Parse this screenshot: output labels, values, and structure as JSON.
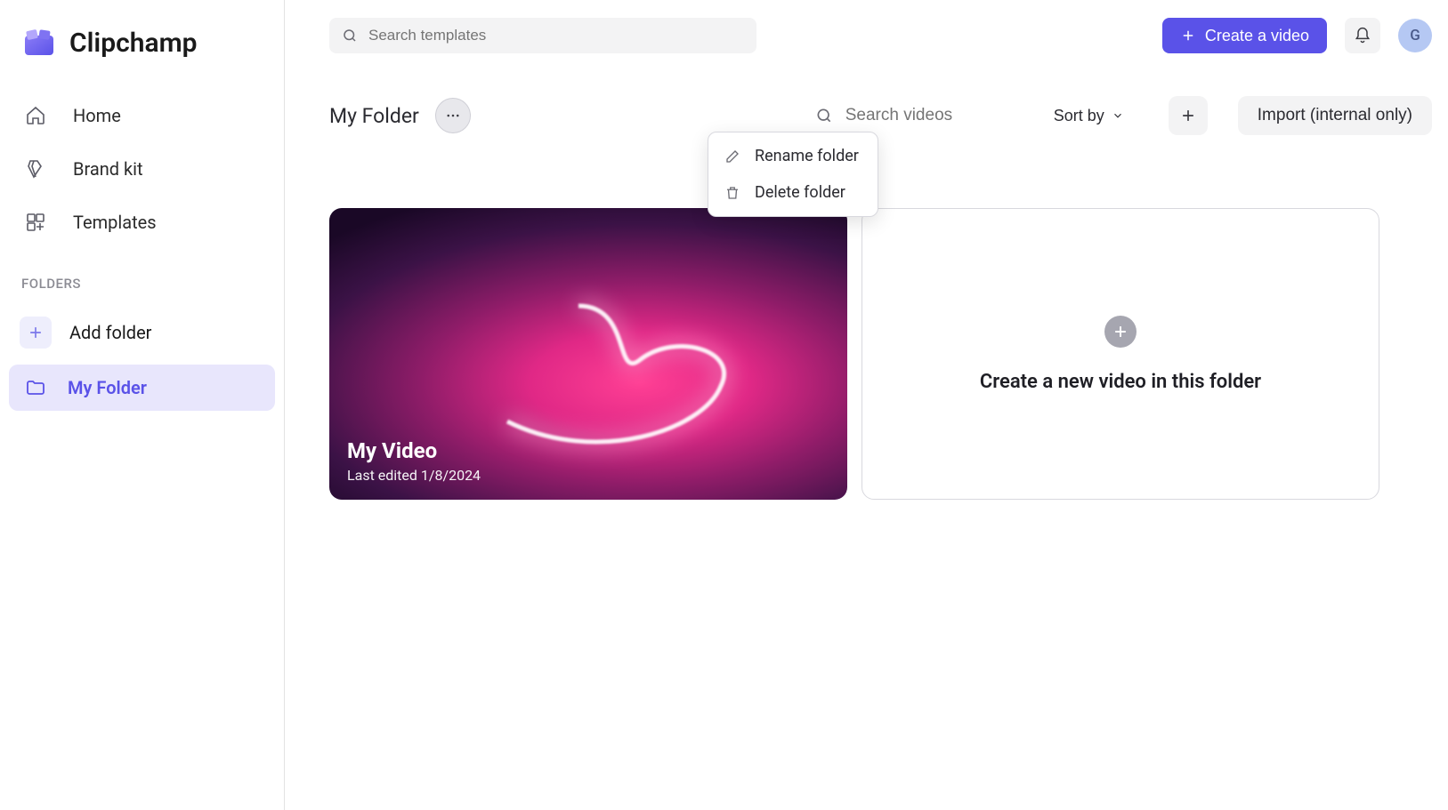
{
  "brand": {
    "name": "Clipchamp"
  },
  "nav": {
    "home": "Home",
    "brandkit": "Brand kit",
    "templates": "Templates"
  },
  "sidebar": {
    "folders_label": "FOLDERS",
    "add_folder": "Add folder",
    "folders": [
      {
        "name": "My Folder",
        "selected": true
      }
    ]
  },
  "search": {
    "templates_placeholder": "Search templates",
    "videos_placeholder": "Search videos"
  },
  "header": {
    "create_video": "Create a video",
    "avatar_initial": "G"
  },
  "page": {
    "title": "My Folder",
    "sort_label": "Sort by",
    "import_label": "Import (internal only)"
  },
  "menu": {
    "rename": "Rename folder",
    "delete": "Delete folder"
  },
  "videos": [
    {
      "title": "My Video",
      "subtitle": "Last edited 1/8/2024"
    }
  ],
  "create_card": {
    "label": "Create a new video in this folder"
  }
}
